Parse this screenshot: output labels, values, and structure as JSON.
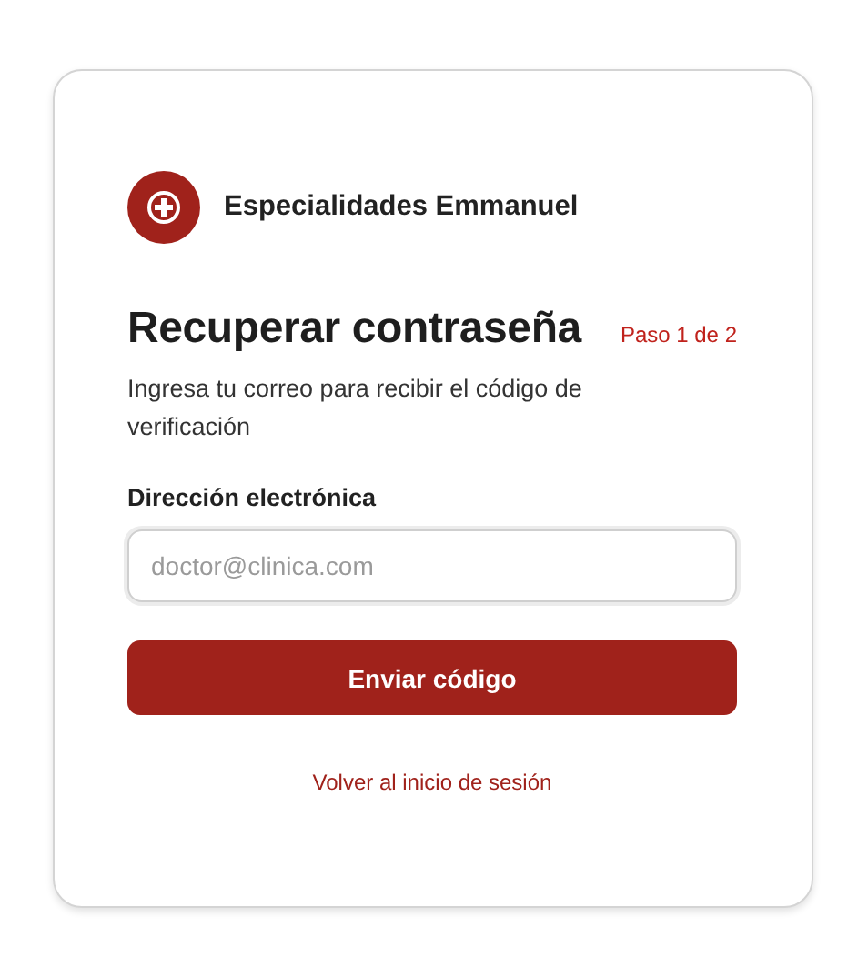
{
  "brand": {
    "name": "Especialidades Emmanuel"
  },
  "heading": {
    "title": "Recuperar contraseña",
    "step": "Paso 1 de 2",
    "description": "Ingresa tu correo para recibir el código de verificación"
  },
  "email_field": {
    "label": "Dirección electrónica",
    "placeholder": "doctor@clinica.com"
  },
  "submit_button": "Enviar código",
  "back_link": "Volver al inicio de sesión"
}
